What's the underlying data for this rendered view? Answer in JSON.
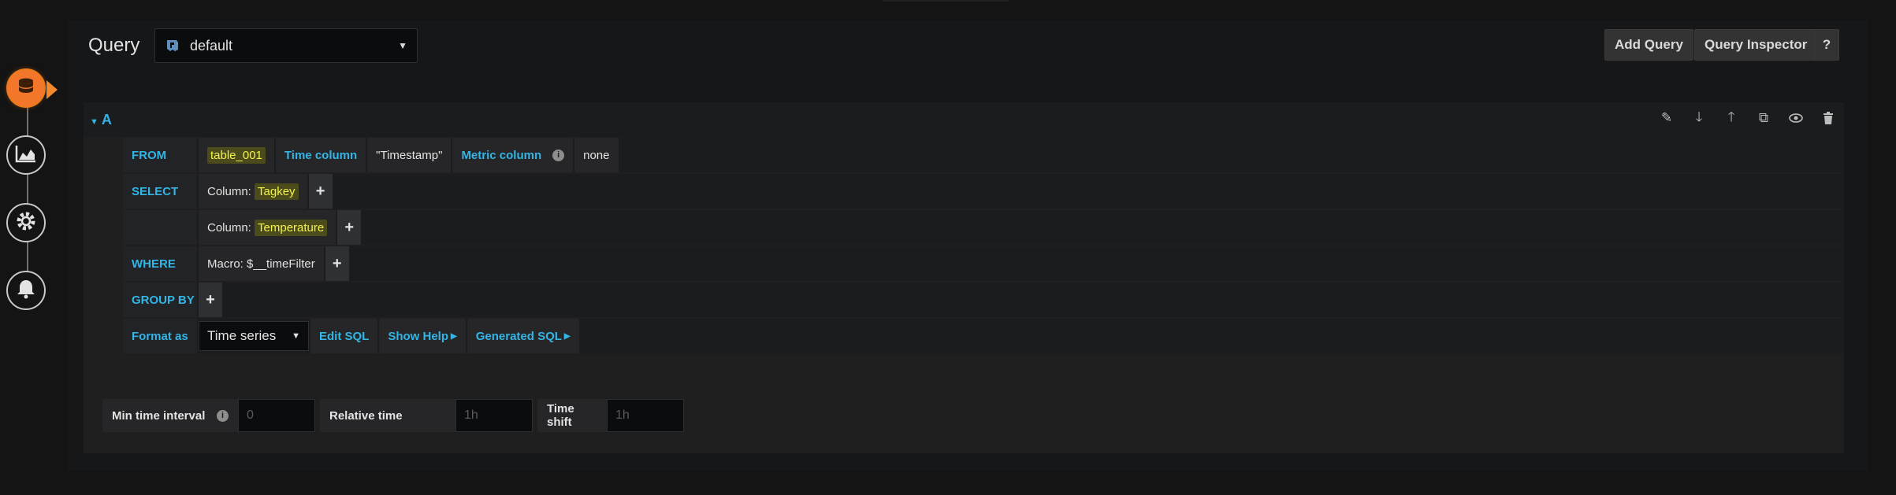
{
  "header": {
    "title": "Query",
    "datasource": "default",
    "buttons": {
      "add_query": "Add Query",
      "query_inspector": "Query Inspector",
      "help": "?"
    }
  },
  "rail": {
    "items": [
      "database-icon",
      "visualization-icon",
      "settings-icon",
      "alert-bell-icon"
    ],
    "active": "database-icon"
  },
  "query": {
    "ref_id": "A",
    "from": {
      "keyword": "FROM",
      "table": "table_001",
      "time_column_label": "Time column",
      "time_column_value": "\"Timestamp\"",
      "metric_column_label": "Metric column",
      "metric_column_value": "none"
    },
    "select": {
      "keyword": "SELECT",
      "columns": [
        {
          "prefix": "Column: ",
          "name": "Tagkey"
        },
        {
          "prefix": "Column: ",
          "name": "Temperature"
        }
      ]
    },
    "where": {
      "keyword": "WHERE",
      "macro": "Macro: $__timeFilter"
    },
    "group_by": {
      "keyword": "GROUP BY"
    },
    "format": {
      "label": "Format as",
      "value": "Time series",
      "edit_sql": "Edit SQL",
      "show_help": "Show Help",
      "generated_sql": "Generated SQL"
    }
  },
  "options": {
    "min_interval_label": "Min time interval",
    "min_interval_placeholder": "0",
    "relative_time_label": "Relative time",
    "relative_time_placeholder": "1h",
    "time_shift_label": "Time shift",
    "time_shift_placeholder": "1h"
  },
  "colors": {
    "accent_blue": "#33b5e5",
    "highlight_yellow": "#f3f34a",
    "active_orange": "#eb7b18"
  }
}
